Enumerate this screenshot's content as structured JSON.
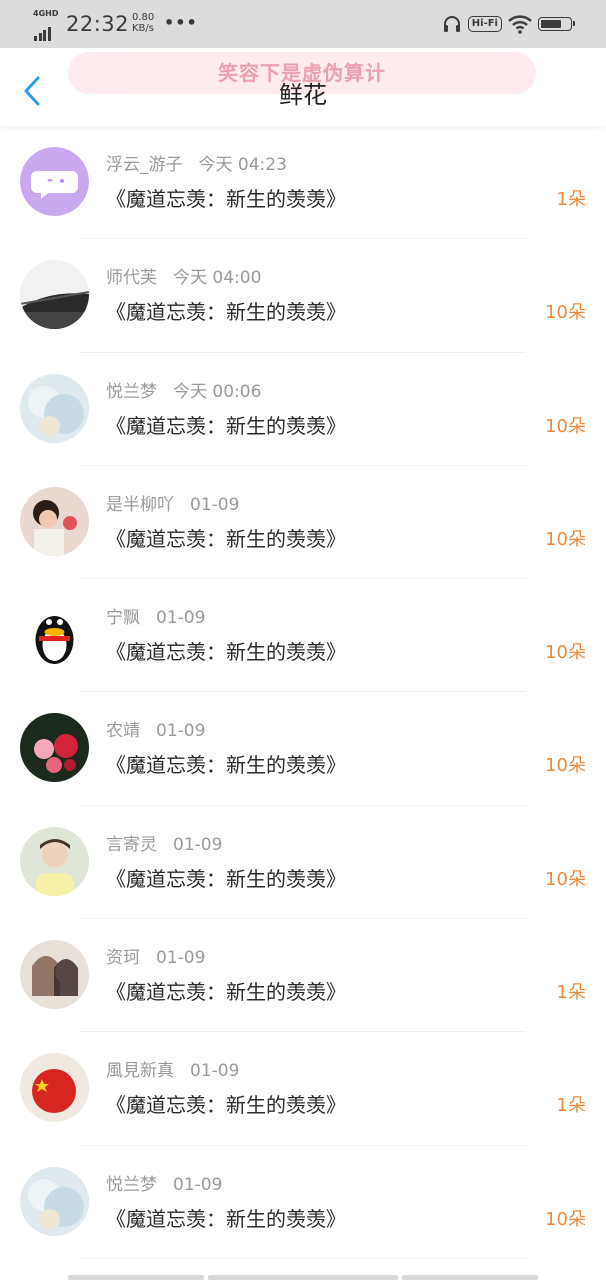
{
  "status_bar": {
    "network": "4GHD",
    "time": "22:32",
    "speed_value": "0.80",
    "speed_unit": "KB/s",
    "more": "•••",
    "hifi": "Hi-Fi",
    "icons": [
      "signal-icon",
      "headphones-icon",
      "wifi-icon",
      "battery-icon"
    ],
    "battery_level": 0.75
  },
  "header": {
    "back_icon": "chevron-left-icon",
    "banner_text": "笑容下是虚伪算计",
    "title": "鲜花"
  },
  "colors": {
    "accent_blue": "#2d9cdb",
    "count_orange": "#ef8a3c",
    "banner_pink": "#e88fa3"
  },
  "items": [
    {
      "user": "浮云_游子",
      "time": "今天 04:23",
      "book": "《魔道忘羡：新生的羡羡》",
      "count": "1朵",
      "avatar": "chat-bubble-avatar"
    },
    {
      "user": "师代芙",
      "time": "今天 04:00",
      "book": "《魔道忘羡：新生的羡羡》",
      "count": "10朵",
      "avatar": "bridge-bw-avatar"
    },
    {
      "user": "悦兰梦",
      "time": "今天 00:06",
      "book": "《魔道忘羡：新生的羡羡》",
      "count": "10朵",
      "avatar": "pastel-anime-avatar"
    },
    {
      "user": "是半柳吖",
      "time": "01-09",
      "book": "《魔道忘羡：新生的羡羡》",
      "count": "10朵",
      "avatar": "child-photo-avatar"
    },
    {
      "user": "宁飘",
      "time": "01-09",
      "book": "《魔道忘羡：新生的羡羡》",
      "count": "10朵",
      "avatar": "penguin-avatar"
    },
    {
      "user": "农靖",
      "time": "01-09",
      "book": "《魔道忘羡：新生的羡羡》",
      "count": "10朵",
      "avatar": "roses-avatar"
    },
    {
      "user": "言寄灵",
      "time": "01-09",
      "book": "《魔道忘羡：新生的羡羡》",
      "count": "10朵",
      "avatar": "portrait-avatar"
    },
    {
      "user": "资珂",
      "time": "01-09",
      "book": "《魔道忘羡：新生的羡羡》",
      "count": "1朵",
      "avatar": "anime-couple-avatar"
    },
    {
      "user": "風見新真",
      "time": "01-09",
      "book": "《魔道忘羡：新生的羡羡》",
      "count": "1朵",
      "avatar": "flag-badge-avatar"
    },
    {
      "user": "悦兰梦",
      "time": "01-09",
      "book": "《魔道忘羡：新生的羡羡》",
      "count": "10朵",
      "avatar": "pastel-anime-avatar"
    }
  ]
}
